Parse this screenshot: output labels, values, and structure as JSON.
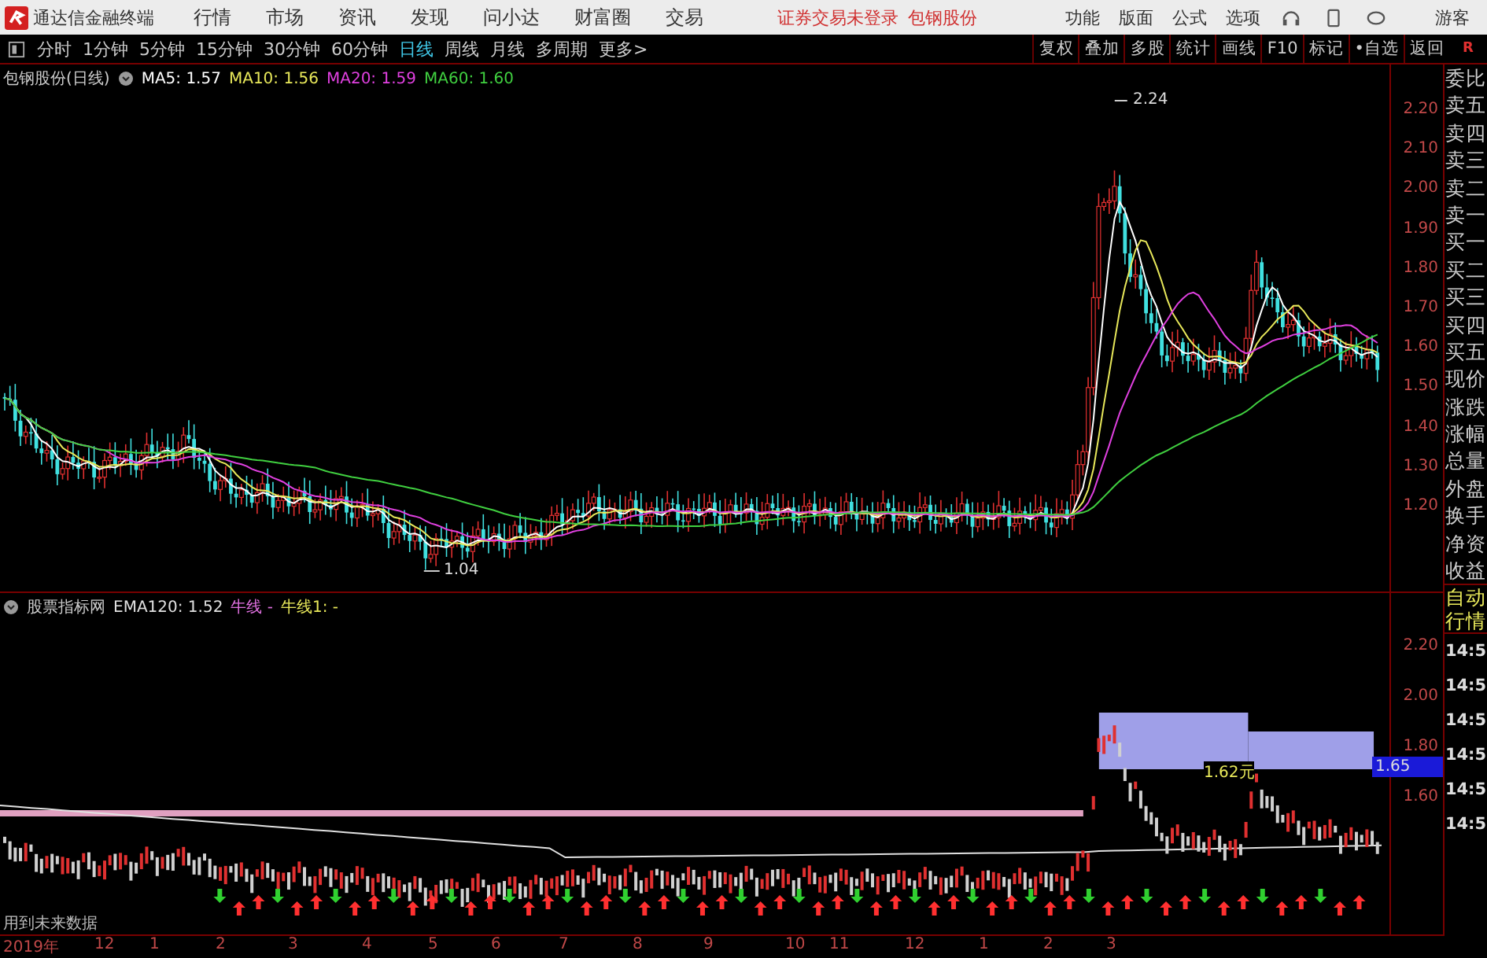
{
  "app": {
    "title": "通达信金融终端",
    "menu": [
      "行情",
      "市场",
      "资讯",
      "发现",
      "问小达",
      "财富圈",
      "交易"
    ],
    "login_status": "证券交易未登录",
    "stock_name": "包钢股份",
    "right_menu": [
      "功能",
      "版面",
      "公式",
      "选项"
    ],
    "user": "游客"
  },
  "toolbar": {
    "periods": [
      {
        "label": "分时",
        "selected": false
      },
      {
        "label": "1分钟",
        "selected": false
      },
      {
        "label": "5分钟",
        "selected": false
      },
      {
        "label": "15分钟",
        "selected": false
      },
      {
        "label": "30分钟",
        "selected": false
      },
      {
        "label": "60分钟",
        "selected": false
      },
      {
        "label": "日线",
        "selected": true
      },
      {
        "label": "周线",
        "selected": false
      },
      {
        "label": "月线",
        "selected": false
      },
      {
        "label": "多周期",
        "selected": false
      },
      {
        "label": "更多>",
        "selected": false
      }
    ],
    "buttons": [
      "复权",
      "叠加",
      "多股",
      "统计",
      "画线",
      "F10",
      "标记",
      "•自选",
      "返回"
    ],
    "corner": "R"
  },
  "price_pane": {
    "title": "包钢股份(日线)",
    "indicators": [
      {
        "label": "MA5: 1.57",
        "color": "#ffffff"
      },
      {
        "label": "MA10: 1.56",
        "color": "#e8e85a"
      },
      {
        "label": "MA20: 1.59",
        "color": "#e040e0"
      },
      {
        "label": "MA60: 1.60",
        "color": "#40d040"
      }
    ],
    "axis_labels": [
      "2.20",
      "2.10",
      "2.00",
      "1.90",
      "1.80",
      "1.70",
      "1.60",
      "1.50",
      "1.40",
      "1.30",
      "1.20"
    ],
    "high_label": "2.24",
    "low_label": "1.04"
  },
  "indicator_pane": {
    "title": "股票指标网",
    "indicators": [
      {
        "label": "EMA120: 1.52",
        "color": "#e0e0e0"
      },
      {
        "label": "牛线 -",
        "color": "#e070e0"
      },
      {
        "label": "牛线1: -",
        "color": "#e8e85a"
      }
    ],
    "axis_labels": [
      "2.20",
      "2.00",
      "1.80",
      "1.60"
    ],
    "current_price": "1.65",
    "price_note": "1.62元",
    "warning": "用到未来数据"
  },
  "date_axis": [
    "2019年",
    "12",
    "1",
    "2",
    "3",
    "4",
    "5",
    "6",
    "7",
    "8",
    "9",
    "10",
    "11",
    "12",
    "1",
    "2",
    "3"
  ],
  "quote_panel": {
    "rows": [
      "委比",
      "卖五",
      "卖四",
      "卖三",
      "卖二",
      "卖一",
      "买一",
      "买二",
      "买三",
      "买四",
      "买五",
      "现价",
      "涨跌",
      "涨幅",
      "总量",
      "外盘",
      "换手",
      "净资",
      "收益"
    ],
    "tabs": [
      "自动",
      "行情"
    ],
    "times": [
      "14:5",
      "14:5",
      "14:5",
      "14:5",
      "14:5",
      "14:5"
    ]
  }
}
